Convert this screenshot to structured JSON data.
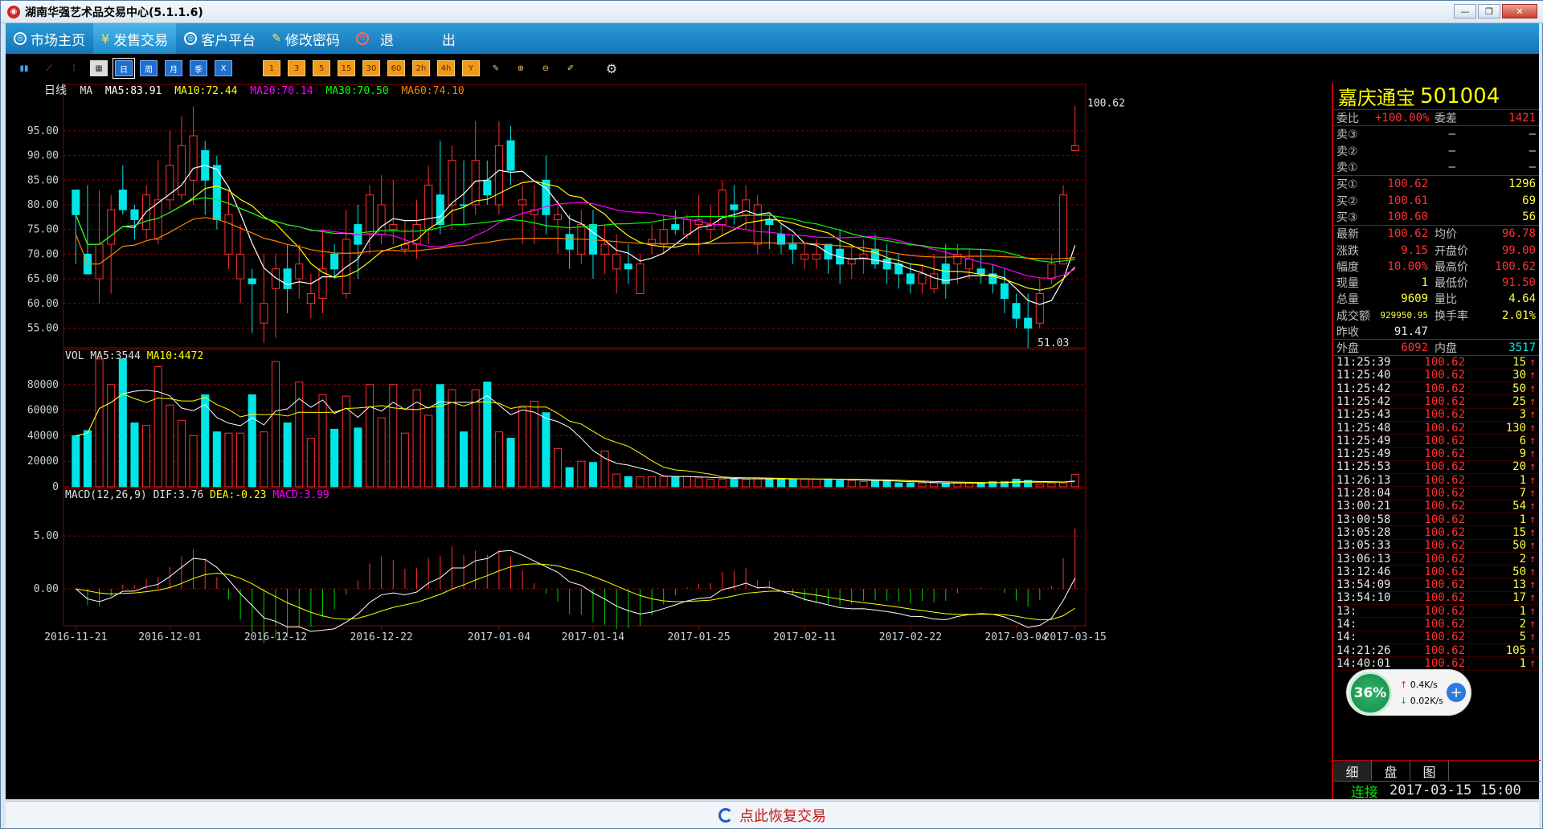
{
  "window": {
    "title": "湖南华强艺术品交易中心(5.1.1.6)"
  },
  "menu": [
    {
      "label": "市场主页",
      "icon": "globe-icon"
    },
    {
      "label": "发售交易",
      "icon": "yen-icon"
    },
    {
      "label": "客户平台",
      "icon": "globe-icon"
    },
    {
      "label": "修改密码",
      "icon": "pen-icon"
    },
    {
      "label": "退",
      "icon": "power-icon"
    },
    {
      "label": "出",
      "icon": ""
    }
  ],
  "toolbar": {
    "left": [
      "bar-chart-icon",
      "line-chart-icon",
      "candlestick-icon",
      "calendar-icon"
    ],
    "periods": [
      "日",
      "周",
      "月",
      "季",
      "X"
    ],
    "minutes": [
      "1",
      "3",
      "5",
      "15",
      "30",
      "60",
      "2h",
      "4h",
      "Y"
    ],
    "tools": [
      "edit-icon",
      "zoom-in-icon",
      "zoom-out-icon",
      "draw-icon",
      "gear-icon"
    ]
  },
  "main_chart": {
    "label": "日线",
    "ma": {
      "name": "MA",
      "ma5": "MA5:83.91",
      "ma10": "MA10:72.44",
      "ma20": "MA20:70.14",
      "ma30": "MA30:70.50",
      "ma60": "MA60:74.10"
    },
    "y_ticks": [
      "95.00",
      "90.00",
      "85.00",
      "80.00",
      "75.00",
      "70.00",
      "65.00",
      "60.00",
      "55.00"
    ],
    "high_label": "100.62",
    "low_label": "51.03",
    "dates": [
      "2016-11-21",
      "2016-12-01",
      "2016-12-12",
      "2016-12-22",
      "2017-01-04",
      "2017-01-14",
      "2017-01-25",
      "2017-02-11",
      "2017-02-22",
      "2017-03-04",
      "2017-03-15"
    ]
  },
  "vol_chart": {
    "name": "VOL",
    "ma5": "MA5:3544",
    "ma10": "MA10:4472",
    "y_ticks": [
      "80000",
      "60000",
      "40000",
      "20000",
      "0"
    ]
  },
  "macd_chart": {
    "name": "MACD(12,26,9)",
    "dif": "DIF:3.76",
    "dea": "DEA:-0.23",
    "macd": "MACD:3.99",
    "y_ticks": [
      "5.00",
      "0.00"
    ]
  },
  "chart_data": {
    "type": "candlestick",
    "candles": [
      [
        83,
        78,
        83,
        68,
        1,
        40000
      ],
      [
        70,
        66,
        84,
        66,
        1,
        44000
      ],
      [
        65,
        72,
        83,
        60,
        0,
        100000
      ],
      [
        72,
        79,
        82,
        62,
        0,
        80000
      ],
      [
        79,
        83,
        88,
        78,
        1,
        100000
      ],
      [
        79,
        77,
        80,
        73,
        1,
        50000
      ],
      [
        75,
        82,
        84,
        73,
        0,
        48000
      ],
      [
        73,
        81,
        89,
        72,
        0,
        94000
      ],
      [
        81,
        88,
        95,
        79,
        0,
        64000
      ],
      [
        82,
        92,
        98,
        81,
        0,
        52000
      ],
      [
        85,
        94,
        100,
        80,
        0,
        40000
      ],
      [
        91,
        85,
        93,
        78,
        1,
        72000
      ],
      [
        88,
        77,
        90,
        75,
        1,
        43000
      ],
      [
        78,
        70,
        83,
        67,
        0,
        42000
      ],
      [
        70,
        65,
        76,
        60,
        0,
        42000
      ],
      [
        65,
        64,
        67,
        54,
        1,
        72000
      ],
      [
        56,
        60,
        70,
        52,
        0,
        43000
      ],
      [
        63,
        67,
        70,
        53,
        0,
        98000
      ],
      [
        67,
        63,
        72,
        58,
        1,
        50000
      ],
      [
        65,
        68,
        72,
        61,
        0,
        82000
      ],
      [
        60,
        62,
        66,
        57,
        0,
        38000
      ],
      [
        61,
        67,
        75,
        58,
        0,
        72000
      ],
      [
        70,
        67,
        72,
        65,
        1,
        45000
      ],
      [
        62,
        73,
        79,
        61,
        0,
        71000
      ],
      [
        72,
        76,
        80,
        65,
        1,
        46000
      ],
      [
        74,
        82,
        84,
        70,
        0,
        80000
      ],
      [
        74,
        80,
        86,
        72,
        0,
        54000
      ],
      [
        76,
        75,
        85,
        72,
        0,
        80000
      ],
      [
        72,
        71,
        77,
        70,
        0,
        42000
      ],
      [
        72,
        76,
        81,
        69,
        0,
        76000
      ],
      [
        75,
        84,
        88,
        72,
        0,
        56000
      ],
      [
        76,
        82,
        93,
        74,
        1,
        80000
      ],
      [
        80,
        89,
        92,
        75,
        0,
        76000
      ],
      [
        80,
        80,
        89,
        76,
        1,
        43000
      ],
      [
        80,
        89,
        97,
        78,
        0,
        76000
      ],
      [
        82,
        85,
        89,
        80,
        1,
        82000
      ],
      [
        80,
        92,
        97,
        78,
        0,
        43000
      ],
      [
        93,
        87,
        96,
        84,
        1,
        38000
      ],
      [
        80,
        81,
        84,
        72,
        0,
        62000
      ],
      [
        78,
        79,
        84,
        72,
        0,
        67000
      ],
      [
        85,
        78,
        90,
        74,
        1,
        58000
      ],
      [
        78,
        77,
        81,
        70,
        0,
        30000
      ],
      [
        74,
        71,
        78,
        67,
        1,
        15000
      ],
      [
        70,
        76,
        79,
        68,
        0,
        20000
      ],
      [
        76,
        70,
        79,
        65,
        1,
        19000
      ],
      [
        72,
        70,
        76,
        66,
        0,
        28000
      ],
      [
        70,
        67,
        74,
        62,
        0,
        10000
      ],
      [
        67,
        68,
        72,
        64,
        1,
        8000
      ],
      [
        62,
        68,
        70,
        62,
        0,
        8000
      ],
      [
        72,
        73,
        76,
        70,
        0,
        8000
      ],
      [
        72,
        75,
        78,
        70,
        0,
        8000
      ],
      [
        75,
        76,
        79,
        74,
        1,
        8000
      ],
      [
        74,
        77,
        78,
        73,
        0,
        8000
      ],
      [
        77,
        76,
        82,
        70,
        0,
        7000
      ],
      [
        76,
        75,
        80,
        73,
        0,
        6000
      ],
      [
        76,
        83,
        85,
        74,
        0,
        6000
      ],
      [
        80,
        79,
        84,
        76,
        1,
        6000
      ],
      [
        78,
        81,
        84,
        75,
        0,
        6000
      ],
      [
        80,
        72,
        82,
        70,
        0,
        7000
      ],
      [
        76,
        77,
        78,
        71,
        1,
        6000
      ],
      [
        74,
        72,
        76,
        70,
        1,
        6000
      ],
      [
        72,
        71,
        74,
        68,
        1,
        6000
      ],
      [
        70,
        69,
        72,
        67,
        0,
        6000
      ],
      [
        69,
        70,
        73,
        67,
        0,
        6000
      ],
      [
        72,
        69,
        72,
        66,
        1,
        6000
      ],
      [
        71,
        68,
        75,
        64,
        1,
        5000
      ],
      [
        68,
        69,
        72,
        65,
        0,
        5000
      ],
      [
        69,
        70,
        73,
        66,
        0,
        4000
      ],
      [
        71,
        68,
        74,
        67,
        1,
        5000
      ],
      [
        69,
        67,
        72,
        64,
        1,
        5000
      ],
      [
        68,
        66,
        70,
        63,
        1,
        3000
      ],
      [
        66,
        64,
        68,
        62,
        1,
        3000
      ],
      [
        64,
        66,
        68,
        62,
        0,
        3000
      ],
      [
        66,
        63,
        70,
        62,
        0,
        3000
      ],
      [
        68,
        64,
        72,
        61,
        1,
        3000
      ],
      [
        70,
        68,
        72,
        64,
        0,
        3000
      ],
      [
        69,
        67,
        71,
        65,
        0,
        3000
      ],
      [
        67,
        66,
        71,
        64,
        1,
        3000
      ],
      [
        66,
        64,
        68,
        62,
        1,
        4000
      ],
      [
        64,
        61,
        67,
        58,
        1,
        4000
      ],
      [
        60,
        57,
        62,
        55,
        1,
        6000
      ],
      [
        57,
        55,
        62,
        51,
        1,
        5000
      ],
      [
        56,
        62,
        65,
        55,
        0,
        2000
      ],
      [
        65,
        68,
        70,
        64,
        0,
        3000
      ],
      [
        68,
        82,
        84,
        68,
        0,
        3000
      ],
      [
        91,
        92,
        100,
        91,
        0,
        9609
      ]
    ]
  },
  "quote": {
    "name": "嘉庆通宝",
    "code": "501004",
    "weibi_label": "委比",
    "weibi": "+100.00%",
    "weicha_label": "委差",
    "weicha": "1421",
    "sells": [
      {
        "label": "卖③",
        "price": "—",
        "vol": "—"
      },
      {
        "label": "卖②",
        "price": "—",
        "vol": "—"
      },
      {
        "label": "卖①",
        "price": "—",
        "vol": "—"
      }
    ],
    "buys": [
      {
        "label": "买①",
        "price": "100.62",
        "vol": "1296"
      },
      {
        "label": "买②",
        "price": "100.61",
        "vol": "69"
      },
      {
        "label": "买③",
        "price": "100.60",
        "vol": "56"
      }
    ],
    "stats": [
      {
        "l1": "最新",
        "v1": "100.62",
        "c1": "red",
        "l2": "均价",
        "v2": "96.78",
        "c2": "red"
      },
      {
        "l1": "涨跌",
        "v1": "9.15",
        "c1": "red",
        "l2": "开盘价",
        "v2": "99.00",
        "c2": "red"
      },
      {
        "l1": "幅度",
        "v1": "10.00%",
        "c1": "red",
        "l2": "最高价",
        "v2": "100.62",
        "c2": "red"
      },
      {
        "l1": "现量",
        "v1": "1",
        "c1": "yel",
        "l2": "最低价",
        "v2": "91.50",
        "c2": "red"
      },
      {
        "l1": "总量",
        "v1": "9609",
        "c1": "yel",
        "l2": "量比",
        "v2": "4.64",
        "c2": "yel"
      },
      {
        "l1": "成交额",
        "v1": "929950.95",
        "c1": "yel",
        "l2": "换手率",
        "v2": "2.01%",
        "c2": "yel"
      }
    ],
    "prev_label": "昨收",
    "prev": "91.47",
    "outer_label": "外盘",
    "outer": "6092",
    "inner_label": "内盘",
    "inner": "3517",
    "ticks": [
      [
        "11:25:39",
        "100.62",
        "15"
      ],
      [
        "11:25:40",
        "100.62",
        "30"
      ],
      [
        "11:25:42",
        "100.62",
        "50"
      ],
      [
        "11:25:42",
        "100.62",
        "25"
      ],
      [
        "11:25:43",
        "100.62",
        "3"
      ],
      [
        "11:25:48",
        "100.62",
        "130"
      ],
      [
        "11:25:49",
        "100.62",
        "6"
      ],
      [
        "11:25:49",
        "100.62",
        "9"
      ],
      [
        "11:25:53",
        "100.62",
        "20"
      ],
      [
        "11:26:13",
        "100.62",
        "1"
      ],
      [
        "11:28:04",
        "100.62",
        "7"
      ],
      [
        "13:00:21",
        "100.62",
        "54"
      ],
      [
        "13:00:58",
        "100.62",
        "1"
      ],
      [
        "13:05:28",
        "100.62",
        "15"
      ],
      [
        "13:05:33",
        "100.62",
        "50"
      ],
      [
        "13:06:13",
        "100.62",
        "2"
      ],
      [
        "13:12:46",
        "100.62",
        "50"
      ],
      [
        "13:54:09",
        "100.62",
        "13"
      ],
      [
        "13:54:10",
        "100.62",
        "17"
      ],
      [
        "13:",
        "100.62",
        "1"
      ],
      [
        "14:",
        "100.62",
        "2"
      ],
      [
        "14:",
        "100.62",
        "5"
      ],
      [
        "14:21:26",
        "100.62",
        "105"
      ],
      [
        "14:40:01",
        "100.62",
        "1"
      ]
    ],
    "tabs": [
      "细",
      "盘",
      "图"
    ],
    "status": "连接",
    "datetime": "2017-03-15 15:00"
  },
  "net_widget": {
    "percent": "36%",
    "up": "0.4K/s",
    "down": "0.02K/s"
  },
  "footer": {
    "text": "点此恢复交易"
  },
  "colors": {
    "up": "#ff3030",
    "down": "#00e5e5",
    "grid": "#8b0000",
    "ma5": "#ffffff",
    "ma10": "#ffff00",
    "ma20": "#ff00ff",
    "ma30": "#00ff00",
    "ma60": "#ff8000"
  }
}
